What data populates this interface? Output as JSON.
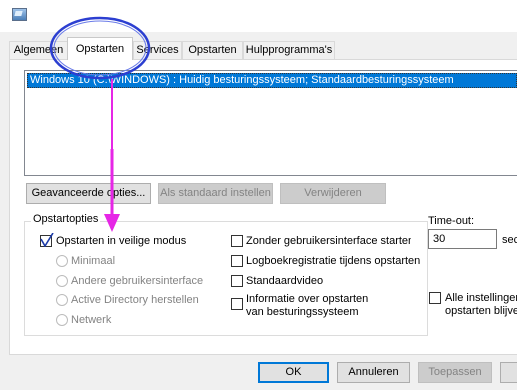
{
  "tabs": [
    {
      "label": "Algemeen",
      "active": false
    },
    {
      "label": "Opstarten",
      "active": true
    },
    {
      "label": "Services",
      "active": false
    },
    {
      "label": "Opstarten",
      "active": false
    },
    {
      "label": "Hulpprogramma's",
      "active": false
    }
  ],
  "boot_list": {
    "selected_entry": "Windows 10 (C:\\WINDOWS) : Huidig besturingssysteem; Standaardbesturingssysteem"
  },
  "boot_buttons": {
    "advanced": "Geavanceerde opties...",
    "set_default": "Als standaard instellen",
    "delete": "Verwijderen"
  },
  "boot_options": {
    "title": "Opstartopties",
    "safe_mode": {
      "label": "Opstarten in veilige modus",
      "checked": true
    },
    "radios": [
      {
        "label": "Minimaal"
      },
      {
        "label": "Andere gebruikersinterface"
      },
      {
        "label": "Active Directory herstellen"
      },
      {
        "label": "Netwerk"
      }
    ],
    "right_checks": [
      {
        "label": "Zonder gebruikersinterface starten",
        "checked": false
      },
      {
        "label": "Logboekregistratie tijdens opstarten",
        "checked": false
      },
      {
        "label": "Standaardvideo",
        "checked": false
      },
      {
        "label_line1": "Informatie over opstarten",
        "label_line2": "van besturingssysteem",
        "checked": false
      }
    ]
  },
  "timeout": {
    "label": "Time-out:",
    "value": "30",
    "unit": "sec",
    "persist_line1": "Alle instellingen",
    "persist_line2": "opstarten blijve"
  },
  "dialog_buttons": {
    "ok": "OK",
    "cancel": "Annuleren",
    "apply": "Toepassen"
  },
  "colors": {
    "selection": "#0078d7",
    "annotation_circle": "#2c3fd1",
    "annotation_arrow": "#e626e6"
  },
  "icons": {
    "app": "system-configuration-icon",
    "check": "checkmark-icon"
  }
}
